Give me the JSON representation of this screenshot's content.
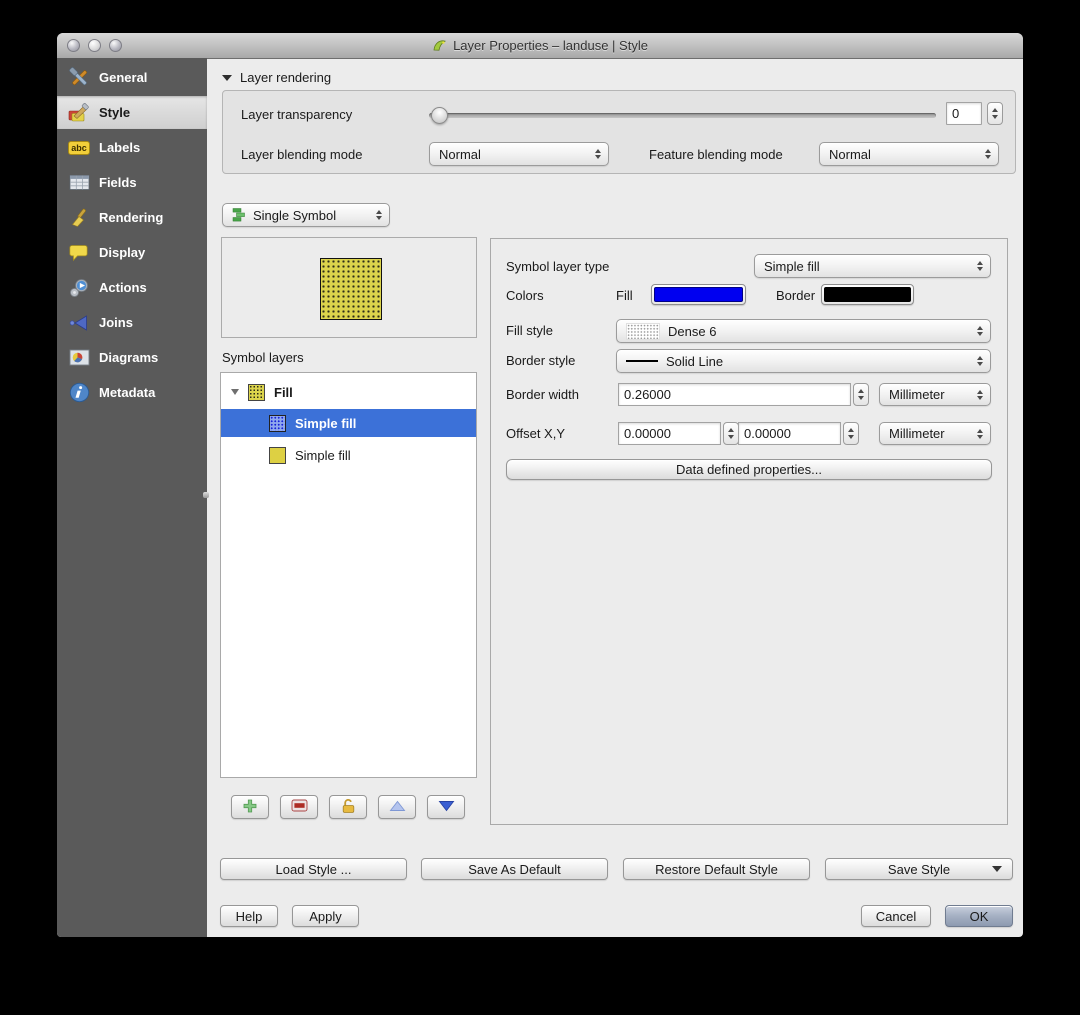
{
  "window": {
    "title": "Layer Properties – landuse | Style"
  },
  "sidebar": {
    "items": [
      {
        "label": "General",
        "icon": "general-icon"
      },
      {
        "label": "Style",
        "icon": "style-icon"
      },
      {
        "label": "Labels",
        "icon": "labels-icon"
      },
      {
        "label": "Fields",
        "icon": "fields-icon"
      },
      {
        "label": "Rendering",
        "icon": "rendering-icon"
      },
      {
        "label": "Display",
        "icon": "display-icon"
      },
      {
        "label": "Actions",
        "icon": "actions-icon"
      },
      {
        "label": "Joins",
        "icon": "joins-icon"
      },
      {
        "label": "Diagrams",
        "icon": "diagrams-icon"
      },
      {
        "label": "Metadata",
        "icon": "metadata-icon"
      }
    ],
    "selected": "Style"
  },
  "icons": {
    "labels_badge": "abc"
  },
  "layer_rendering": {
    "header": "Layer rendering",
    "transparency_label": "Layer transparency",
    "transparency_value": "0",
    "layer_blending_label": "Layer blending mode",
    "layer_blending_value": "Normal",
    "feature_blending_label": "Feature blending mode",
    "feature_blending_value": "Normal"
  },
  "renderer": {
    "value": "Single Symbol"
  },
  "symbol_layers": {
    "label": "Symbol layers",
    "root_label": "Fill",
    "children": [
      {
        "label": "Simple fill"
      },
      {
        "label": "Simple fill"
      }
    ],
    "selected_child_index": 0
  },
  "properties": {
    "symbol_layer_type_label": "Symbol layer type",
    "symbol_layer_type_value": "Simple fill",
    "colors_label": "Colors",
    "fill_label": "Fill",
    "fill_color": "#0000f0",
    "border_label": "Border",
    "border_color": "#000000",
    "fill_style_label": "Fill style",
    "fill_style_value": "Dense 6",
    "border_style_label": "Border style",
    "border_style_value": "Solid Line",
    "border_width_label": "Border width",
    "border_width_value": "0.26000",
    "border_width_unit": "Millimeter",
    "offset_label": "Offset X,Y",
    "offset_x_value": "0.00000",
    "offset_y_value": "0.00000",
    "offset_unit": "Millimeter",
    "data_defined_label": "Data defined properties..."
  },
  "style_buttons": {
    "load": "Load Style ...",
    "save_as_default": "Save As Default",
    "restore_default": "Restore Default Style",
    "save_style": "Save Style"
  },
  "dialog_buttons": {
    "help": "Help",
    "apply": "Apply",
    "cancel": "Cancel",
    "ok": "OK"
  }
}
